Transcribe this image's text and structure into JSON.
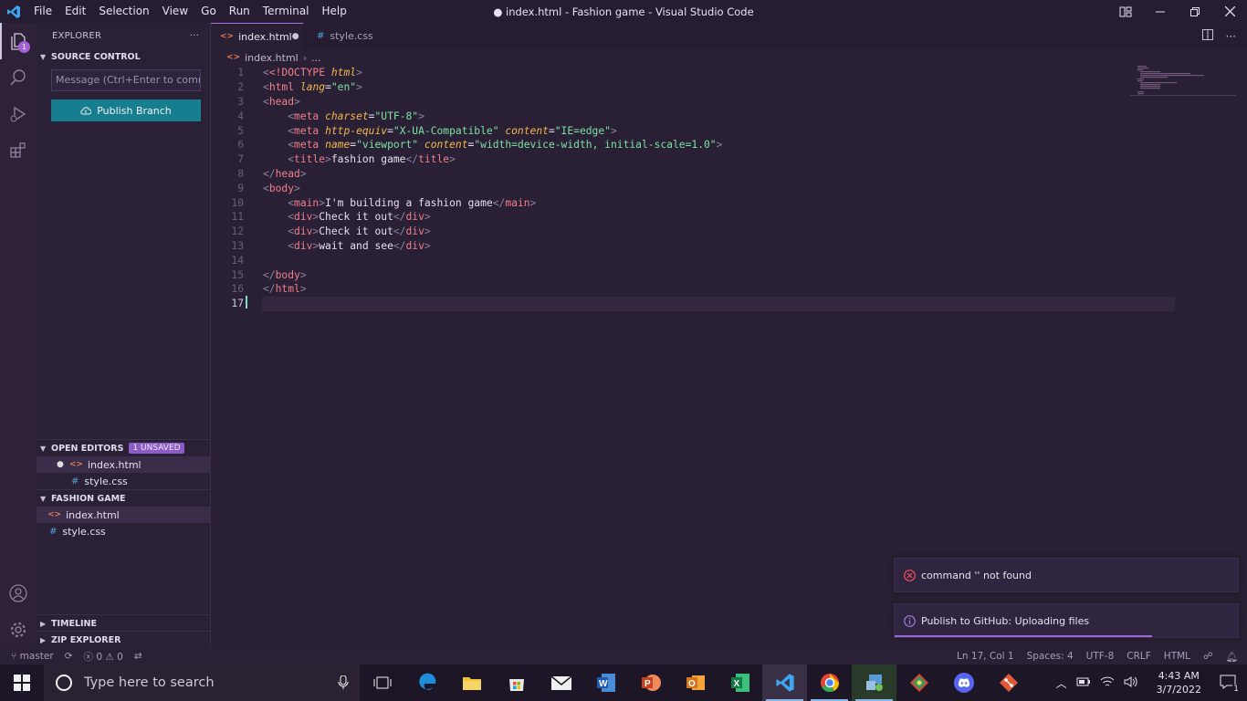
{
  "window": {
    "title": "● index.html - Fashion game - Visual Studio Code",
    "menu": [
      "File",
      "Edit",
      "Selection",
      "View",
      "Go",
      "Run",
      "Terminal",
      "Help"
    ]
  },
  "activity_bar": {
    "scm_badge": "1"
  },
  "sidebar": {
    "title": "EXPLORER",
    "more": "···",
    "source_control": {
      "header": "SOURCE CONTROL",
      "commit_placeholder": "Message (Ctrl+Enter to commit...",
      "publish_button": "Publish Branch"
    },
    "open_editors": {
      "header": "OPEN EDITORS",
      "badge": "1 UNSAVED",
      "files": [
        "index.html",
        "style.css"
      ]
    },
    "folder": {
      "header": "FASHION GAME",
      "files": [
        "index.html",
        "style.css"
      ]
    },
    "timeline": "TIMELINE",
    "zip_explorer": "ZIP EXPLORER"
  },
  "tabs": [
    {
      "label": "index.html",
      "active": true,
      "unsaved": true
    },
    {
      "label": "style.css",
      "active": false,
      "unsaved": false
    }
  ],
  "breadcrumb": {
    "file": "index.html",
    "more": "..."
  },
  "editor": {
    "line_numbers": [
      "1",
      "2",
      "3",
      "4",
      "5",
      "6",
      "7",
      "8",
      "9",
      "10",
      "11",
      "12",
      "13",
      "14",
      "15",
      "16",
      "17"
    ],
    "lines": {
      "l1_doctype": "<!DOCTYPE",
      "l1_html": "html",
      "l2_tag": "html",
      "l2_attr": "lang",
      "l2_val": "\"en\"",
      "l3_tag": "head",
      "l4_tag": "meta",
      "l4_attr": "charset",
      "l4_val": "\"UTF-8\"",
      "l5_tag": "meta",
      "l5_attr1": "http-equiv",
      "l5_val1": "\"X-UA-Compatible\"",
      "l5_attr2": "content",
      "l5_val2": "\"IE=edge\"",
      "l6_tag": "meta",
      "l6_attr1": "name",
      "l6_val1": "\"viewport\"",
      "l6_attr2": "content",
      "l6_val2": "\"width=device-width, initial-scale=1.0\"",
      "l7_tag": "title",
      "l7_text": "fashion game",
      "l8_tag": "head",
      "l9_tag": "body",
      "l10_tag": "main",
      "l10_text": "I'm building a fashion game",
      "l11_tag": "div",
      "l11_text": "Check it out",
      "l12_tag": "div",
      "l12_text": "Check it out",
      "l13_tag": "div",
      "l13_text": "wait and see",
      "l15_tag": "body",
      "l16_tag": "html"
    }
  },
  "notifications": [
    {
      "type": "error",
      "text": "command '' not found"
    },
    {
      "type": "info",
      "text": "Publish to GitHub: Uploading files",
      "progress": 0.75
    }
  ],
  "status_bar": {
    "branch": "master",
    "errors": "0",
    "warnings": "0",
    "position": "Ln 17, Col 1",
    "spaces": "Spaces: 4",
    "encoding": "UTF-8",
    "eol": "CRLF",
    "language": "HTML"
  },
  "taskbar": {
    "search_placeholder": "Type here to search",
    "apps": [
      "task-view",
      "edge",
      "file-explorer",
      "store",
      "mail",
      "word",
      "powerpoint",
      "outlook",
      "excel",
      "vscode",
      "chrome",
      "git-gui",
      "sourcetree",
      "discord",
      "git"
    ],
    "time": "4:43 AM",
    "date": "3/7/2022",
    "notification_count": "1"
  },
  "colors": {
    "accent": "#b070e0",
    "publish_button": "#177e8f",
    "background": "#2a2035",
    "error": "#f05060"
  }
}
